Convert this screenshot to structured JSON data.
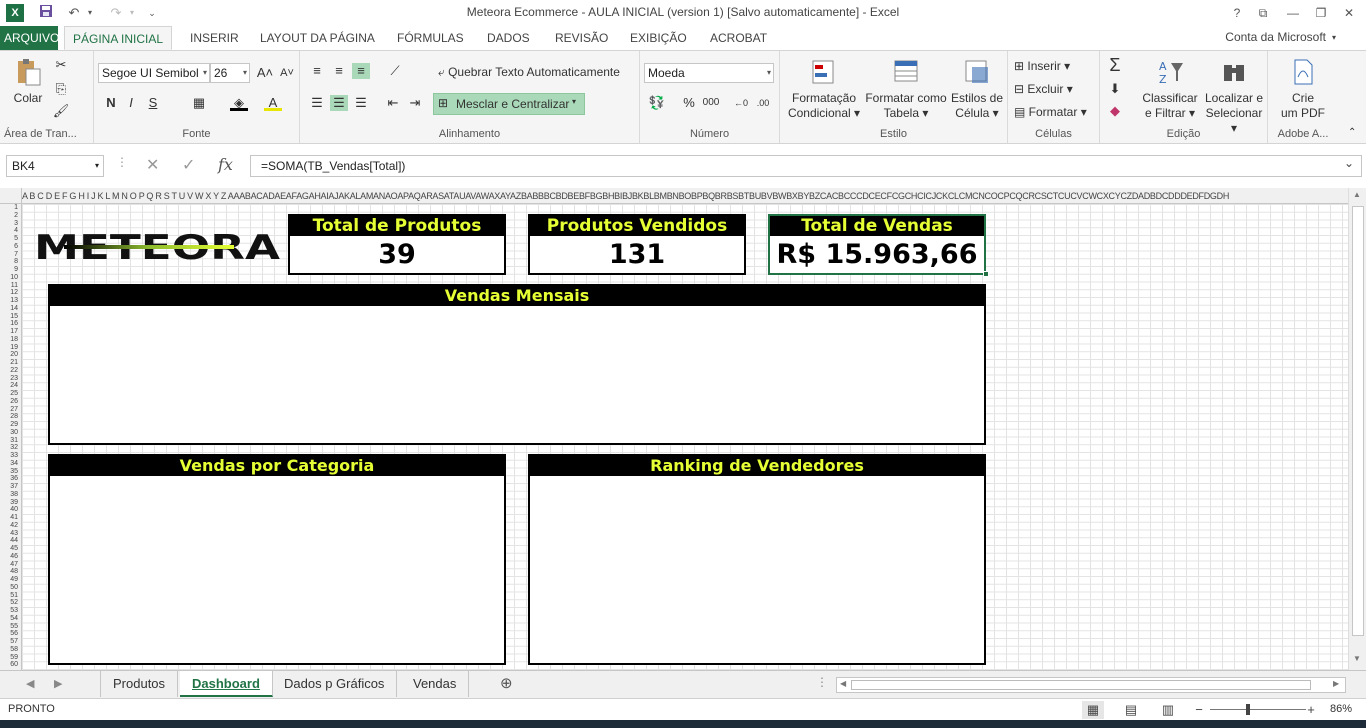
{
  "window": {
    "title": "Meteora Ecommerce - AULA INICIAL (version 1) [Salvo automaticamente] - Excel",
    "app_icon": "X"
  },
  "ribbon_tabs": [
    "ARQUIVO",
    "PÁGINA INICIAL",
    "INSERIR",
    "LAYOUT DA PÁGINA",
    "FÓRMULAS",
    "DADOS",
    "REVISÃO",
    "EXIBIÇÃO",
    "ACROBAT"
  ],
  "account": "Conta da Microsoft",
  "ribbon": {
    "clipboard": {
      "paste": "Colar",
      "label": "Área de Tran..."
    },
    "font": {
      "name": "Segoe UI Semibol",
      "size": "26",
      "bold": "N",
      "italic": "I",
      "underline": "S",
      "label": "Fonte"
    },
    "alignment": {
      "wrap": "Quebrar Texto Automaticamente",
      "merge": "Mesclar e Centralizar",
      "label": "Alinhamento"
    },
    "number": {
      "format": "Moeda",
      "percent": "%",
      "thousands": "000",
      "label": "Número"
    },
    "styles": {
      "conditional": "Formatação",
      "conditional2": "Condicional",
      "table": "Formatar como",
      "table2": "Tabela",
      "cell": "Estilos de",
      "cell2": "Célula",
      "label": "Estilo"
    },
    "cells": {
      "insert": "Inserir",
      "delete": "Excluir",
      "format": "Formatar",
      "label": "Células"
    },
    "editing": {
      "sort": "Classificar",
      "sort2": "e Filtrar",
      "find": "Localizar e",
      "find2": "Selecionar",
      "label": "Edição"
    },
    "acrobat": {
      "create": "Crie",
      "create2": "um PDF",
      "label": "Adobe A..."
    }
  },
  "formula_bar": {
    "name_box": "BK4",
    "formula": "=SOMA(TB_Vendas[Total])"
  },
  "column_headers": "A B C D E F G H I J K L M N O P Q R S T U V W X Y Z AAABACADAEAFAGAHAIAJAKALAMANAOAPAQARASATAUAVAWAXAYAZBABBBCBDBEBFBGBHBIBJBKBLBMBNBOBPBQBRBSBTBUBVBWBXBYBZCACBCCCDCECFCGCHCICJCKCLCMCNCOCPCQCRCSCTCUCVCWCXCYCZDADBDCDDDEDFDGDH",
  "row_headers": [
    "1",
    "2",
    "3",
    "4",
    "5",
    "6",
    "7",
    "8",
    "9",
    "10",
    "11",
    "12",
    "13",
    "14",
    "15",
    "16",
    "17",
    "18",
    "19",
    "20",
    "21",
    "22",
    "23",
    "24",
    "25",
    "26",
    "27",
    "28",
    "29",
    "30",
    "31",
    "32",
    "33",
    "34",
    "35",
    "36",
    "37",
    "38",
    "39",
    "40",
    "41",
    "42",
    "43",
    "44",
    "45",
    "46",
    "47",
    "48",
    "49",
    "50",
    "51",
    "52",
    "53",
    "54",
    "55",
    "56",
    "57",
    "58",
    "59",
    "60"
  ],
  "dashboard": {
    "logo_text": "METEORA",
    "kpis": [
      {
        "title": "Total de Produtos",
        "value": "39"
      },
      {
        "title": "Produtos Vendidos",
        "value": "131"
      },
      {
        "title": "Total de Vendas",
        "value": "R$ 15.963,66"
      }
    ],
    "panels": {
      "monthly": "Vendas Mensais",
      "category": "Vendas por Categoria",
      "ranking": "Ranking de Vendedores"
    }
  },
  "sheet_tabs": [
    "Produtos",
    "Dashboard",
    "Dados p Gráficos",
    "Vendas"
  ],
  "active_sheet": "Dashboard",
  "status": {
    "text": "PRONTO",
    "zoom": "86%"
  },
  "colors": {
    "excel_green": "#217346",
    "header_text": "#e6ff34",
    "header_bg": "#000000"
  }
}
